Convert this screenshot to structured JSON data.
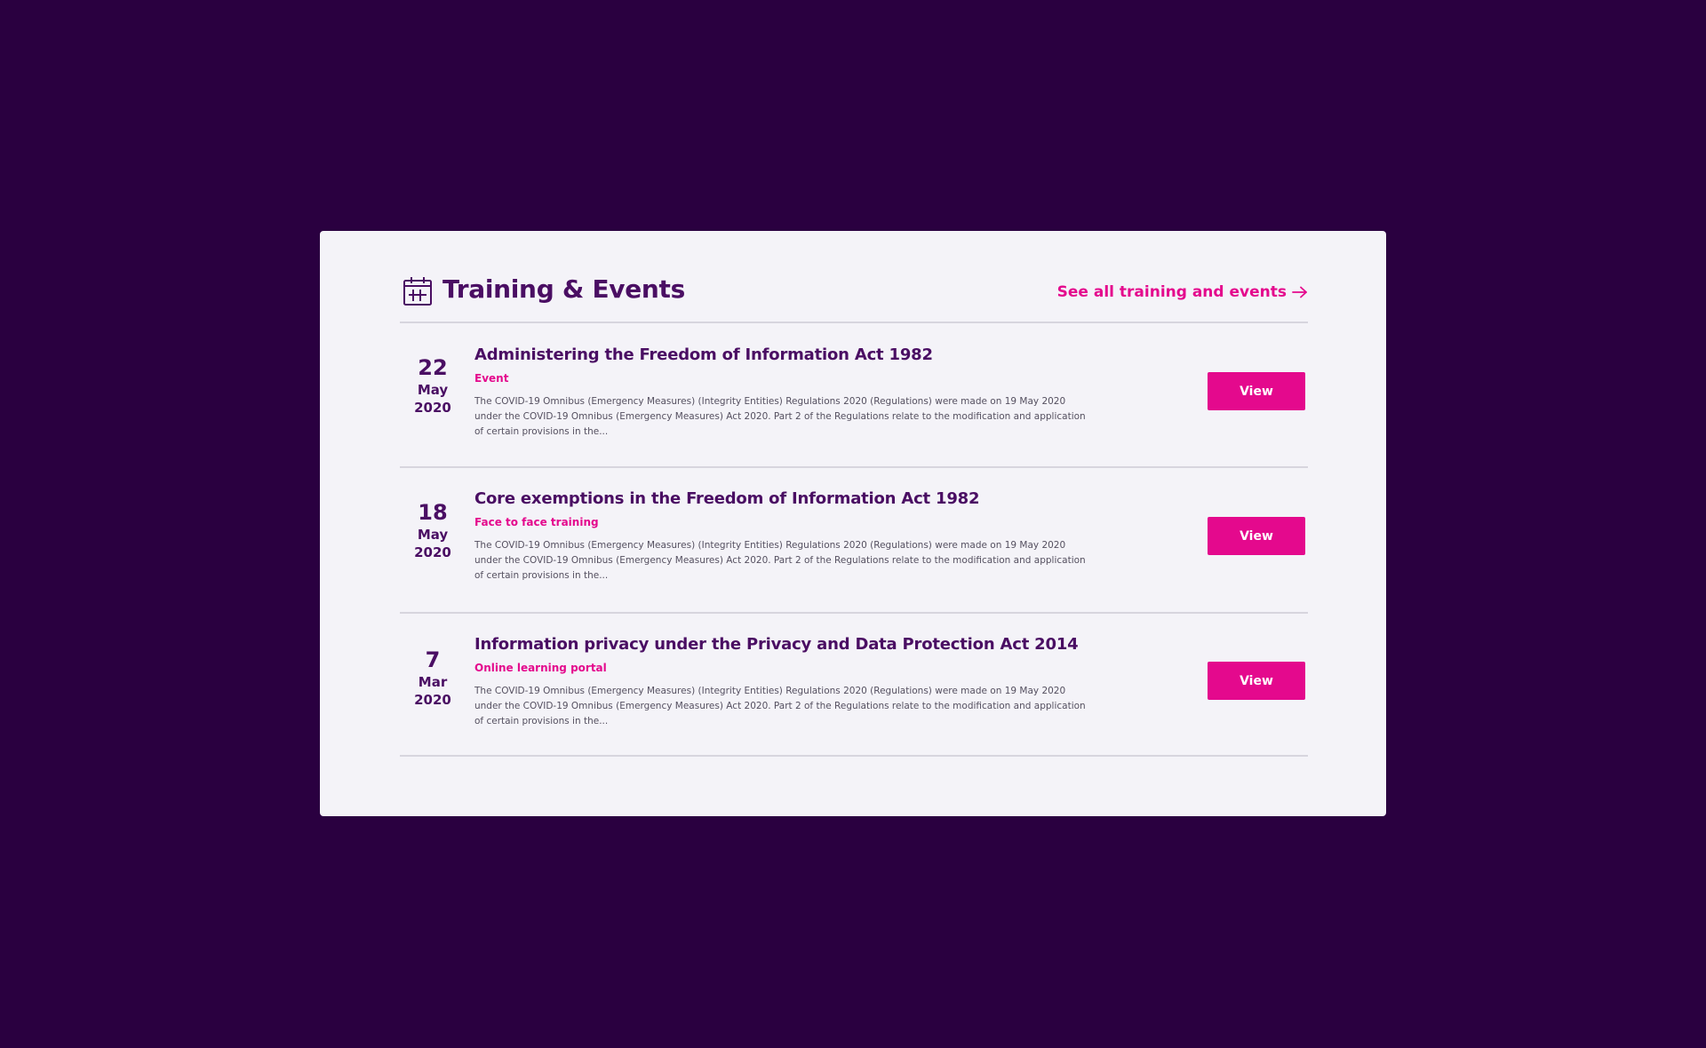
{
  "section": {
    "title": "Training & Events",
    "see_all_label": "See all training and events",
    "icon": "calendar-icon",
    "accent_color": "#e4098d",
    "heading_color": "#4a0e63",
    "background_color": "#2a0040"
  },
  "events": [
    {
      "day": "22",
      "month": "May",
      "year": "2020",
      "title": "Administering the Freedom of Information Act 1982",
      "type": "Event",
      "description": "The COVID-19 Omnibus (Emergency Measures) (Integrity Entities) Regulations 2020 (Regulations) were made on 19 May 2020 under the COVID-19 Omnibus (Emergency Measures) Act 2020. Part 2 of the Regulations relate to the modification and application of certain provisions in the...",
      "button_label": "View"
    },
    {
      "day": "18",
      "month": "May",
      "year": "2020",
      "title": "Core exemptions in the Freedom of Information Act 1982",
      "type": "Face to face training",
      "description": "The COVID-19 Omnibus (Emergency Measures) (Integrity Entities) Regulations 2020 (Regulations) were made on 19 May 2020 under the COVID-19 Omnibus (Emergency Measures) Act 2020. Part 2 of the Regulations relate to the modification and application of certain provisions in the...",
      "button_label": "View"
    },
    {
      "day": "7",
      "month": "Mar",
      "year": "2020",
      "title": "Information privacy under the Privacy and Data Protection Act 2014",
      "type": "Online learning portal",
      "description": "The COVID-19 Omnibus (Emergency Measures) (Integrity Entities) Regulations 2020 (Regulations) were made on 19 May 2020 under the COVID-19 Omnibus (Emergency Measures) Act 2020. Part 2 of the Regulations relate to the modification and application of certain provisions in the...",
      "button_label": "View"
    }
  ]
}
